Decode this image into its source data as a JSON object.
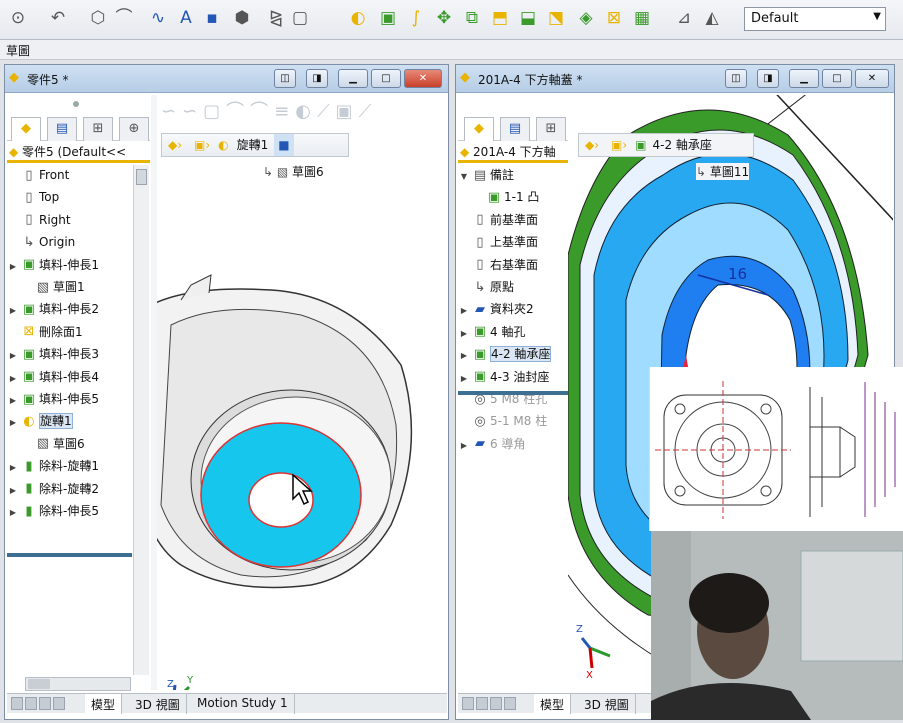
{
  "toolbar": {
    "tools": [
      "select-arrow-icon",
      "sketch-arc-icon",
      "polygon-icon",
      "fillet-sketch-icon",
      "spline-icon",
      "text-icon",
      "point-icon",
      "view-cube-icon",
      "mirror-icon",
      "offset-icon",
      "revolve-icon",
      "extrude-icon",
      "sweep-icon",
      "pattern-icon",
      "linear-pattern-icon",
      "boss-icon",
      "cut-icon",
      "loft-icon",
      "shell-icon",
      "delete-face-icon",
      "wrap-icon",
      "measure-icon",
      "appearance-icon"
    ],
    "display_state": "Default"
  },
  "command_tab": {
    "label": "草圖"
  },
  "left_window": {
    "title": "零件5 *",
    "root": "零件5  (Default<<",
    "tree": [
      {
        "label": "Front",
        "icon": "plane-icon",
        "expander": false,
        "indent": 0
      },
      {
        "label": "Top",
        "icon": "plane-icon",
        "expander": false,
        "indent": 0
      },
      {
        "label": "Right",
        "icon": "plane-icon",
        "expander": false,
        "indent": 0
      },
      {
        "label": "Origin",
        "icon": "origin-icon",
        "expander": false,
        "indent": 0
      },
      {
        "label": "填料-伸長1",
        "icon": "extrude-icon",
        "expander": true,
        "indent": 0
      },
      {
        "label": "草圖1",
        "icon": "sketch-icon",
        "expander": false,
        "indent": 1
      },
      {
        "label": "填料-伸長2",
        "icon": "extrude-icon",
        "expander": true,
        "indent": 0
      },
      {
        "label": "刪除面1",
        "icon": "delete-face-icon",
        "expander": false,
        "indent": 0
      },
      {
        "label": "填料-伸長3",
        "icon": "extrude-icon",
        "expander": true,
        "indent": 0
      },
      {
        "label": "填料-伸長4",
        "icon": "extrude-icon",
        "expander": true,
        "indent": 0
      },
      {
        "label": "填料-伸長5",
        "icon": "extrude-icon",
        "expander": true,
        "indent": 0
      },
      {
        "label": "旋轉1",
        "icon": "revolve-icon",
        "expander": true,
        "indent": 0,
        "selected": true
      },
      {
        "label": "草圖6",
        "icon": "sketch-icon",
        "expander": false,
        "indent": 1
      },
      {
        "label": "除料-旋轉1",
        "icon": "cut-revolve-icon",
        "expander": true,
        "indent": 0
      },
      {
        "label": "除料-旋轉2",
        "icon": "cut-revolve-icon",
        "expander": true,
        "indent": 0
      },
      {
        "label": "除料-伸長5",
        "icon": "cut-extrude-icon",
        "expander": true,
        "indent": 0
      }
    ],
    "breadcrumb": [
      "part-icon",
      "body-icon",
      "旋轉1",
      "face-icon"
    ],
    "breadcrumb_sub": "草圖6",
    "tabs": [
      "模型",
      "3D 視圖",
      "Motion Study 1"
    ]
  },
  "right_window": {
    "title": "201A-4 下方軸蓋 *",
    "root": "201A-4 下方軸",
    "tree": [
      {
        "label": "備註",
        "icon": "annotation-icon",
        "expander": true,
        "expanded": true,
        "indent": 0
      },
      {
        "label": "1-1 凸",
        "icon": "extrude-icon",
        "expander": false,
        "indent": 1
      },
      {
        "label": "前基準面",
        "icon": "plane-icon",
        "expander": false,
        "indent": 0
      },
      {
        "label": "上基準面",
        "icon": "plane-icon",
        "expander": false,
        "indent": 0
      },
      {
        "label": "右基準面",
        "icon": "plane-icon",
        "expander": false,
        "indent": 0
      },
      {
        "label": "原點",
        "icon": "origin-icon",
        "expander": false,
        "indent": 0
      },
      {
        "label": "資料夾2",
        "icon": "folder-icon",
        "expander": true,
        "indent": 0
      },
      {
        "label": "4 軸孔",
        "icon": "extrude-icon",
        "expander": true,
        "indent": 0
      },
      {
        "label": "4-2 軸承座",
        "icon": "extrude-icon",
        "expander": true,
        "indent": 0,
        "selected": true
      },
      {
        "label": "4-3 油封座",
        "icon": "extrude-icon",
        "expander": true,
        "indent": 0
      },
      {
        "label": "5 M8 柱孔",
        "icon": "hole-icon",
        "expander": false,
        "indent": 0,
        "dim": true
      },
      {
        "label": "5-1 M8 柱",
        "icon": "hole-icon",
        "expander": false,
        "indent": 0,
        "dim": true
      },
      {
        "label": "6 導角",
        "icon": "folder-icon",
        "expander": true,
        "indent": 0,
        "dim": true
      }
    ],
    "breadcrumb": [
      "part-icon",
      "body-icon",
      "4-2 軸承座"
    ],
    "breadcrumb_sub": "草圖11",
    "dimension": "16",
    "tabs": [
      "模型",
      "3D 視圖"
    ]
  }
}
